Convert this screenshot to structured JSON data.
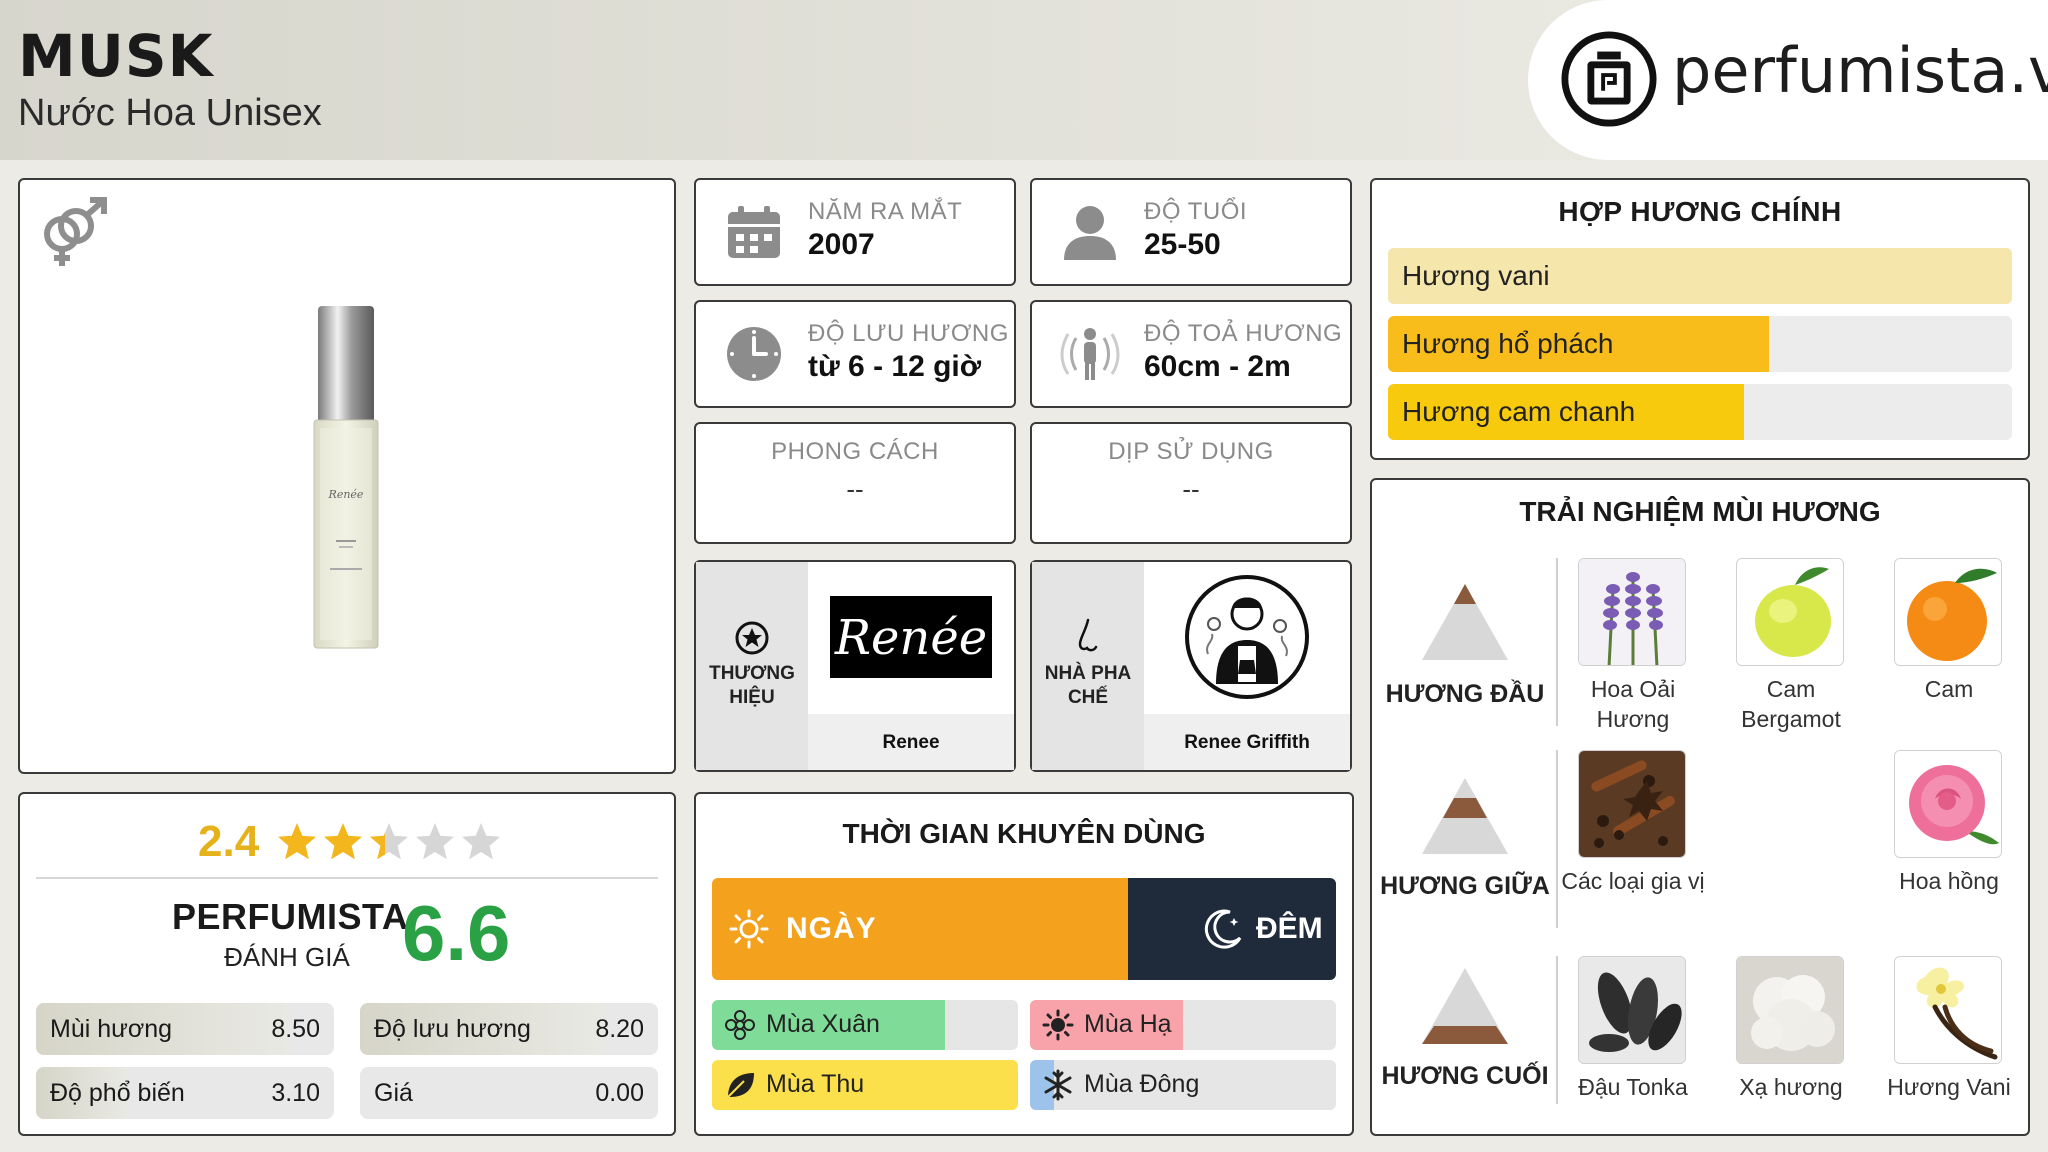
{
  "header": {
    "title": "MUSK",
    "subtitle": "Nước Hoa Unisex",
    "logo_text": "perfumista.vn"
  },
  "rating": {
    "stars_value": "2.4",
    "stars_fraction": 0.48,
    "brand_label": "PERFUMISTA",
    "brand_sub": "ĐÁNH GIÁ",
    "score": "6.6",
    "metrics": [
      {
        "label": "Mùi hương",
        "value": "8.50",
        "fraction": 0.85
      },
      {
        "label": "Độ lưu hương",
        "value": "8.20",
        "fraction": 0.82
      },
      {
        "label": "Độ phổ biến",
        "value": "3.10",
        "fraction": 0.31
      },
      {
        "label": "Giá",
        "value": "0.00",
        "fraction": 0.0
      }
    ]
  },
  "info": {
    "launch": {
      "label": "NĂM RA MẮT",
      "value": "2007",
      "icon": "calendar-icon"
    },
    "age": {
      "label": "ĐỘ TUỔI",
      "value": "25-50",
      "icon": "person-icon"
    },
    "longevity": {
      "label": "ĐỘ LƯU HƯƠNG",
      "value": "từ 6 - 12 giờ",
      "icon": "clock-icon"
    },
    "sillage": {
      "label": "ĐỘ TOẢ HƯƠNG",
      "value": "60cm - 2m",
      "icon": "radiate-person-icon"
    },
    "style": {
      "label": "PHONG CÁCH",
      "value": "--"
    },
    "occasion": {
      "label": "DỊP SỬ DỤNG",
      "value": "--"
    }
  },
  "brand": {
    "side_label_line1": "THƯƠNG",
    "side_label_line2": "HIỆU",
    "name": "Renee",
    "logo_script": "Renée"
  },
  "perfumer": {
    "side_label_line1": "NHÀ PHA",
    "side_label_line2": "CHẾ",
    "name": "Renee Griffith"
  },
  "accords": {
    "title": "HỢP HƯƠNG CHÍNH",
    "items": [
      {
        "label": "Hương vani",
        "fraction": 1.0,
        "color": "#f5e6ab"
      },
      {
        "label": "Hương hổ phách",
        "fraction": 0.61,
        "color": "#f8bd1b"
      },
      {
        "label": "Hương cam chanh",
        "fraction": 0.57,
        "color": "#f8ca0d"
      }
    ]
  },
  "time": {
    "title": "THỜI GIAN KHUYÊN DÙNG",
    "day_label": "NGÀY",
    "night_label": "ĐÊM",
    "day_fraction": 0.667,
    "seasons": [
      {
        "label": "Mùa Xuân",
        "fraction": 0.76,
        "color": "#7fdc98",
        "icon": "flower-icon"
      },
      {
        "label": "Mùa Hạ",
        "fraction": 0.5,
        "color": "#f7a3a9",
        "icon": "sun-icon"
      },
      {
        "label": "Mùa Thu",
        "fraction": 1.0,
        "color": "#fbe04c",
        "icon": "leaf-icon"
      },
      {
        "label": "Mùa Đông",
        "fraction": 0.08,
        "color": "#9ec3ea",
        "icon": "snowflake-icon"
      }
    ]
  },
  "notes": {
    "title": "TRẢI NGHIỆM MÙI HƯƠNG",
    "top": {
      "label": "HƯƠNG ĐẦU",
      "items": [
        "Hoa Oải Hương",
        "Cam Bergamot",
        "Cam"
      ]
    },
    "middle": {
      "label": "HƯƠNG GIỮA",
      "items": [
        "Các loại gia vị",
        "Hoa hồng"
      ]
    },
    "base": {
      "label": "HƯƠNG CUỐI",
      "items": [
        "Đậu Tonka",
        "Xạ hương",
        "Hương Vani"
      ]
    }
  },
  "colors": {
    "score_green": "#2aa144",
    "star_gold": "#f3b61c",
    "day_orange": "#f4a11d",
    "night_navy": "#1f2a3a"
  }
}
